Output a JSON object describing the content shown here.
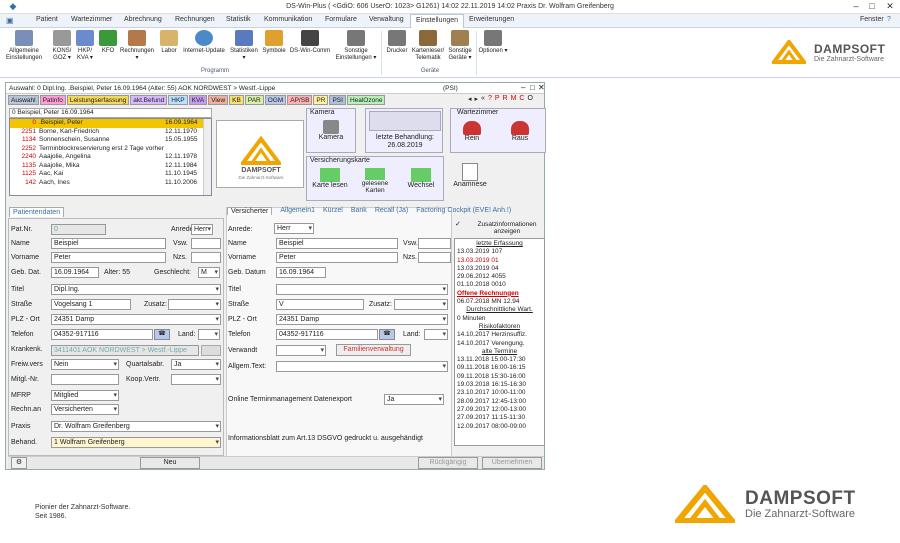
{
  "window": {
    "title": "DS-Win-Plus ( <GdiO: 606 UserO: 1023> G1261)   14:02  22.11.2019  14:02  Praxis Dr. Wolfram Greifenberg",
    "controls": [
      "–",
      "□",
      "✕"
    ]
  },
  "menu": {
    "items": [
      "Patient",
      "Wartezimmer",
      "Abrechnung",
      "Rechnungen",
      "Statistik",
      "Kommunikation",
      "Formulare",
      "Verwaltung",
      "Einstellungen",
      "Erweiterungen"
    ],
    "active_index": 8,
    "right_label": "Fenster"
  },
  "ribbon": {
    "buttons": [
      {
        "label": "Allgemeine Einstellungen",
        "color": "#7a8fb8"
      },
      {
        "label": "KONS/ GOZ ▾",
        "color": "#888"
      },
      {
        "label": "HKP/ KVA ▾",
        "color": "#6a8ccf"
      },
      {
        "label": "KFO",
        "color": "#3a9a3a"
      },
      {
        "label": "Rechnungen ▾",
        "color": "#b4794a"
      },
      {
        "label": "Labor",
        "color": "#d9b36a"
      },
      {
        "label": "Internet-Update",
        "color": "#4a8ac8"
      },
      {
        "label": "Statistiken ▾",
        "color": "#5a7ac0"
      },
      {
        "label": "Symbole",
        "color": "#e0a030"
      },
      {
        "label": "DS-Win-Comm",
        "color": "#444"
      },
      {
        "label": "Sonstige Einstellungen ▾",
        "color": "#777"
      },
      {
        "label": "Drucker",
        "color": "#777"
      },
      {
        "label": "Kartenleser/ Telematik",
        "color": "#8a6a3a"
      },
      {
        "label": "Sonstige Geräte ▾",
        "color": "#a08050"
      },
      {
        "label": "Optionen ▾",
        "color": "#777"
      }
    ],
    "groups": [
      "Programm",
      "Geräte"
    ]
  },
  "brand": {
    "name": "DAMPSOFT",
    "tagline": "Die Zahnarzt-Software",
    "slogan_1": "Pionier der Zahnarzt-Software.",
    "slogan_2": "Seit 1986.",
    "accent": "#f0a500"
  },
  "dialog": {
    "title": "Auswahl: 0  Dipl.Ing. .Beispiel, Peter  16.09.1964  (Alter: 55)  AOK NORDWEST > Westf.-Lippe",
    "title_right": "(PSI)",
    "tabs": [
      {
        "label": "Auswahl",
        "bg": "#b8c4d8"
      },
      {
        "label": "Patinfo",
        "bg": "#ff9ed8"
      },
      {
        "label": "Leistungserfassung",
        "bg": "#f5d95a"
      },
      {
        "label": "akt.Befund",
        "bg": "#d8b8ff"
      },
      {
        "label": "HKP",
        "bg": "#b8e0ff"
      },
      {
        "label": "KVA",
        "bg": "#c69cf0"
      },
      {
        "label": "View",
        "bg": "#f0b0a0"
      },
      {
        "label": "KB",
        "bg": "#f8e070"
      },
      {
        "label": "PAR",
        "bg": "#d8f0a8"
      },
      {
        "label": "OGM",
        "bg": "#b8c8e8"
      },
      {
        "label": "AP/SB",
        "bg": "#ffb0b0"
      },
      {
        "label": "PR",
        "bg": "#fff0a0"
      },
      {
        "label": "PSI",
        "bg": "#b0c0d8"
      },
      {
        "label": "HealOzone",
        "bg": "#b8f0b8"
      }
    ],
    "selected_patient": "0  Beispiel, Peter  16.09.1964",
    "patients": [
      {
        "no": "0",
        "name": ".Beispiel, Peter",
        "date": "16.09.1964"
      },
      {
        "no": "2251",
        "name": "Borne, Karl-Friedrich",
        "date": "12.11.1970"
      },
      {
        "no": "1134",
        "name": "Sonnenschein, Susanne",
        "date": "15.05.1955"
      },
      {
        "no": "2252",
        "name": "Terminblockreservierung erst 2 Tage vorher",
        "date": ""
      },
      {
        "no": "2240",
        "name": "Aaajolie, Angelina",
        "date": "12.11.1978"
      },
      {
        "no": "1135",
        "name": "Aaajolie, Mika",
        "date": "12.11.1984"
      },
      {
        "no": "1125",
        "name": "Aac, Kai",
        "date": "11.10.1945"
      },
      {
        "no": "142",
        "name": "Aach, Ines",
        "date": "11.10.2006"
      }
    ],
    "kamera": {
      "title": "Kamera",
      "button": "Kamera"
    },
    "letzte": {
      "label": "letzte Behandlung:",
      "date": "26.08.2019"
    },
    "wartezimmer": {
      "title": "Wartezimmer",
      "rein": "Rein",
      "raus": "Raus"
    },
    "versicherungskarte": {
      "title": "Versicherungskarte",
      "read": "Karte lesen",
      "read_cards": "gelesene Karten",
      "change": "Wechsel"
    },
    "anamnese": "Anamnese",
    "left_tab": "Patientendaten",
    "left": {
      "patnr": {
        "label": "Pat.Nr.",
        "value": "0"
      },
      "anrede": {
        "label": "Anrede:",
        "value": "Herr"
      },
      "name": {
        "label": "Name",
        "value": "Beispiel"
      },
      "vsw": {
        "label": "Vsw."
      },
      "vorname": {
        "label": "Vorname",
        "value": "Peter"
      },
      "nzs": {
        "label": "Nzs."
      },
      "gebdat": {
        "label": "Geb. Dat.",
        "value": "16.09.1964"
      },
      "alter": "Alter: 55",
      "geschlecht": {
        "label": "Geschlecht:",
        "value": "M"
      },
      "titel": {
        "label": "Titel",
        "value": "Dipl.Ing."
      },
      "strasse": {
        "label": "Straße",
        "value": "Vogelsang 1"
      },
      "zusatz": {
        "label": "Zusatz:"
      },
      "plz": {
        "label": "PLZ - Ort",
        "value": "24351 Damp"
      },
      "telefon": {
        "label": "Telefon",
        "value": "04352-917116"
      },
      "land": {
        "label": "Land:"
      },
      "krankenk": {
        "label": "Krankenk.",
        "value": "3411401 AOK NORDWEST > Westf.-Lippe"
      },
      "freiw": {
        "label": "Freiw.vers",
        "value": "Nein"
      },
      "quartal": {
        "label": "Quartalsabr.",
        "value": "Ja"
      },
      "mitgl": {
        "label": "Mitgl.-Nr."
      },
      "koop": {
        "label": "Koop.Vertr."
      },
      "mfrp": {
        "label": "MFRP",
        "value": "Mitglied"
      },
      "rechn": {
        "label": "Rechn.an",
        "value": "Versicherten"
      },
      "praxis": {
        "label": "Praxis",
        "value": "Dr. Wolfram Greifenberg"
      },
      "behand": {
        "label": "Behand.",
        "value": "1  Wolfram Greifenberg"
      }
    },
    "right_tabs": [
      "Versicherter",
      "Allgemein1",
      "Kürzel",
      "Bank",
      "Recall (Ja)",
      "Factoring Cockpit (EVE! Anh.!)"
    ],
    "right": {
      "anrede": {
        "label": "Anrede:",
        "value": "Herr"
      },
      "name": {
        "label": "Name",
        "value": "Beispiel"
      },
      "vsw": {
        "label": "Vsw."
      },
      "vorname": {
        "label": "Vorname",
        "value": "Peter"
      },
      "nzs": {
        "label": "Nzs."
      },
      "gebdat": {
        "label": "Geb. Datum",
        "value": "16.09.1964"
      },
      "titel": {
        "label": "Titel"
      },
      "strasse": {
        "label": "Straße",
        "value": "V"
      },
      "zusatz": {
        "label": "Zusatz:"
      },
      "plz": {
        "label": "PLZ - Ort",
        "value": "24351 Damp"
      },
      "telefon": {
        "label": "Telefon",
        "value": "04352-917116"
      },
      "land": {
        "label": "Land:"
      },
      "verwandt": {
        "label": "Verwandt",
        "button": "Familienverwaltung"
      },
      "allgem": {
        "label": "Allgem.Text:"
      },
      "online": {
        "label": "Online Terminmanagement Datenexport",
        "value": "Ja"
      },
      "info": "Informationsblatt zum Art.13 DSGVO gedruckt u. ausgehändigt"
    },
    "zusatz_label": "Zusatzinformationen anzeigen",
    "notes": [
      {
        "t": "letzte Erfassung",
        "c": "h"
      },
      {
        "t": "13.03.2019 107",
        "c": ""
      },
      {
        "t": "13.03.2019 01",
        "c": "r"
      },
      {
        "t": "13.03.2019 04",
        "c": ""
      },
      {
        "t": "29.06.2012 4055",
        "c": ""
      },
      {
        "t": "01.10.2018 0010",
        "c": ""
      },
      {
        "t": "Offene Rechnungen",
        "c": "hr"
      },
      {
        "t": "06.07.2018 MN        12.94",
        "c": ""
      },
      {
        "t": "Durchschnittliche Wart.",
        "c": "h"
      },
      {
        "t": "0 Minuten",
        "c": ""
      },
      {
        "t": "Risikofaktoren",
        "c": "h"
      },
      {
        "t": "14.10.2017 Herzinsuffiz.",
        "c": ""
      },
      {
        "t": "14.10.2017 Verengung.",
        "c": ""
      },
      {
        "t": "alte Termine",
        "c": "h"
      },
      {
        "t": "13.11.2018    15:00-17:30",
        "c": ""
      },
      {
        "t": "09.11.2018    16:00-16:15",
        "c": ""
      },
      {
        "t": "09.11.2018    15:30-16:00",
        "c": ""
      },
      {
        "t": "19.03.2018    16:15-16:30",
        "c": ""
      },
      {
        "t": "23.10.2017    10:00-11:00",
        "c": ""
      },
      {
        "t": "28.09.2017    12:45-13:00",
        "c": ""
      },
      {
        "t": "27.09.2017    12:00-13:00",
        "c": ""
      },
      {
        "t": "27.09.2017    11:15-11:30",
        "c": ""
      },
      {
        "t": "12.09.2017    08:00-09:00",
        "c": ""
      }
    ],
    "buttons": {
      "new": "Neu",
      "undo": "Rückgängig",
      "apply": "Übernehmen"
    }
  }
}
